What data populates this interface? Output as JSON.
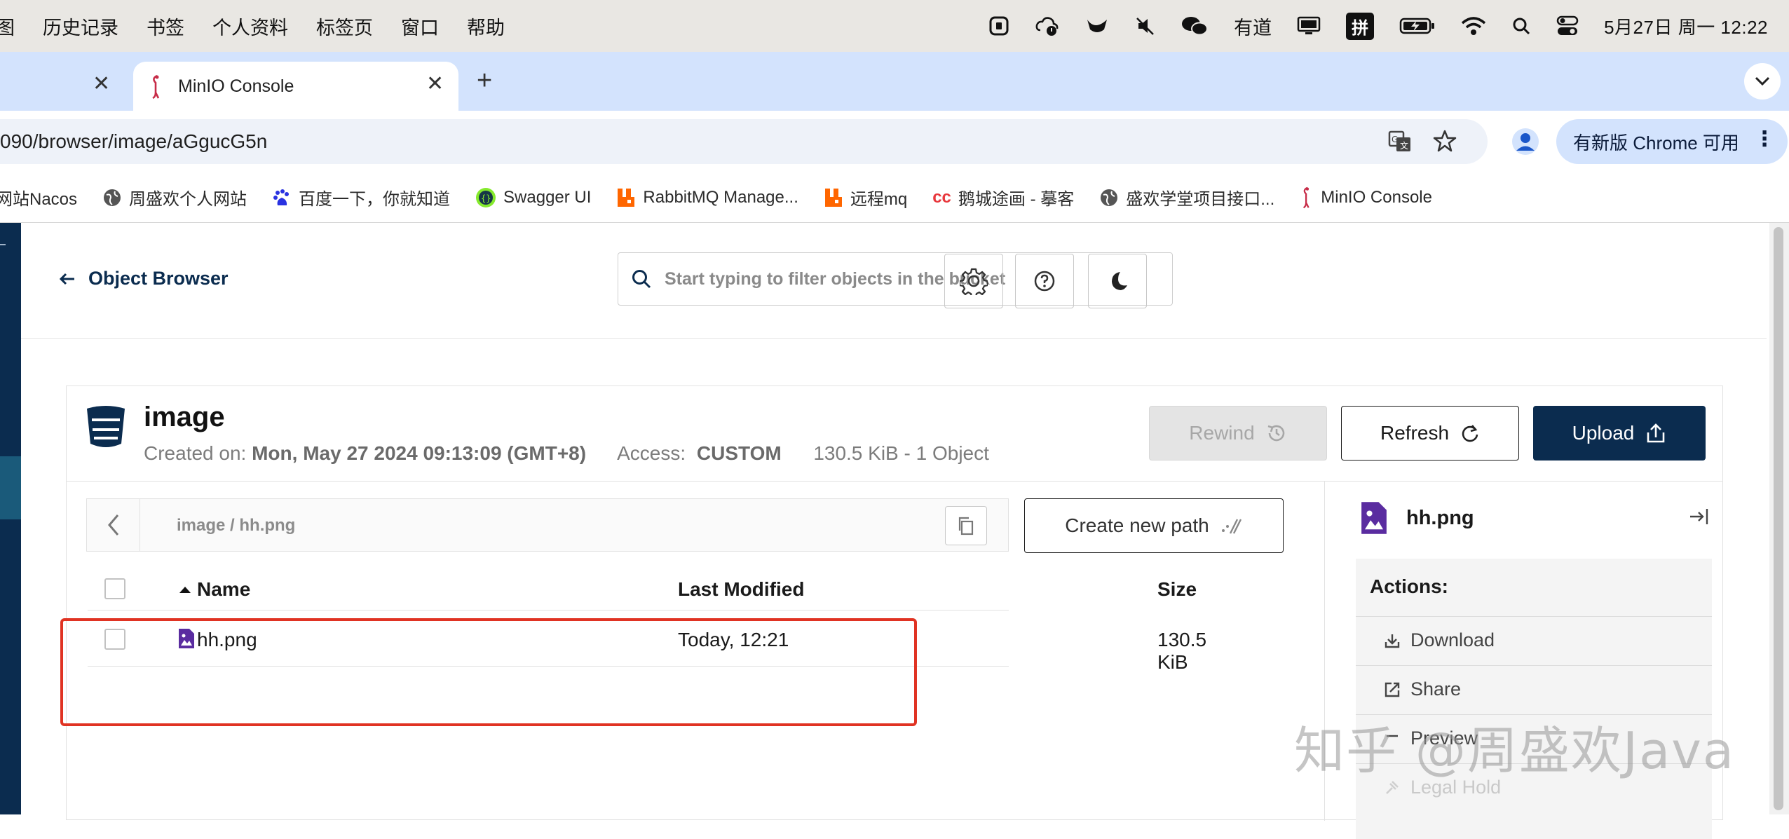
{
  "menubar": {
    "items": [
      "图",
      "历史记录",
      "书签",
      "个人资料",
      "标签页",
      "窗口",
      "帮助"
    ],
    "status_text": "有道",
    "input_method": "拼",
    "clock": "5月27日 周一 12:22"
  },
  "tabs": [
    {
      "title": ""
    },
    {
      "title": "MinIO Console"
    }
  ],
  "addressbar": {
    "url": "090/browser/image/aGgucG5n",
    "update_label": "有新版 Chrome 可用"
  },
  "bookmarks": [
    {
      "label": "网站Nacos",
      "icon": "nacos-icon"
    },
    {
      "label": "周盛欢个人网站",
      "icon": "globe-icon"
    },
    {
      "label": "百度一下，你就知道",
      "icon": "baidu-icon"
    },
    {
      "label": "Swagger UI",
      "icon": "swagger-icon"
    },
    {
      "label": "RabbitMQ Manage...",
      "icon": "rabbitmq-icon"
    },
    {
      "label": "远程mq",
      "icon": "rabbitmq-icon"
    },
    {
      "label": "鹅城途画 - 摹客",
      "icon": "mockplus-icon"
    },
    {
      "label": "盛欢学堂项目接口...",
      "icon": "globe-icon"
    },
    {
      "label": "MinIO Console",
      "icon": "minio-icon"
    }
  ],
  "header": {
    "back_label": "Object Browser",
    "search_placeholder": "Start typing to filter objects in the bucket"
  },
  "bucket": {
    "name": "image",
    "created_label": "Created on:",
    "created_value": "Mon, May 27 2024 09:13:09 (GMT+8)",
    "access_label": "Access:",
    "access_value": "CUSTOM",
    "usage": "130.5 KiB - 1 Object",
    "rewind_label": "Rewind",
    "refresh_label": "Refresh",
    "upload_label": "Upload"
  },
  "browser": {
    "path": "image / hh.png",
    "create_path_label": "Create new path",
    "columns": {
      "name": "Name",
      "modified": "Last Modified",
      "size": "Size"
    },
    "rows": [
      {
        "name": "hh.png",
        "modified": "Today, 12:21",
        "size": "130.5 KiB"
      }
    ]
  },
  "detail": {
    "filename": "hh.png",
    "actions_title": "Actions:",
    "actions": [
      {
        "label": "Download",
        "enabled": true
      },
      {
        "label": "Share",
        "enabled": true
      },
      {
        "label": "Preview",
        "enabled": true
      },
      {
        "label": "Legal Hold",
        "enabled": false
      }
    ]
  },
  "watermark": "知乎 @周盛欢Java",
  "colors": {
    "brand_navy": "#0b2c4f",
    "highlight_red": "#e03323",
    "tab_strip": "#d3e3fd"
  }
}
